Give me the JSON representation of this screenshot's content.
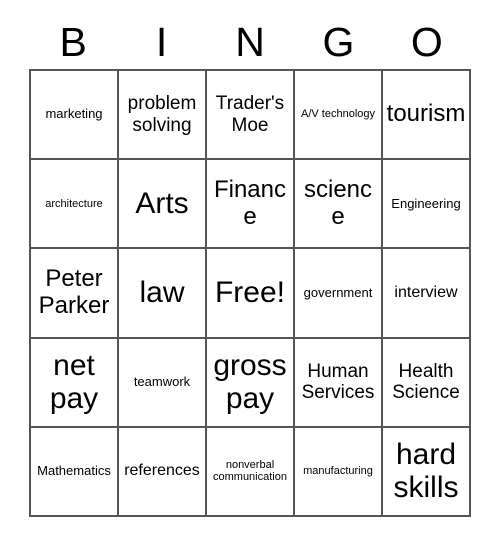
{
  "header": {
    "letters": [
      "B",
      "I",
      "N",
      "G",
      "O"
    ]
  },
  "grid": {
    "columns": 5,
    "rows": 5,
    "border_color": "#555555",
    "cell_background": "#ffffff",
    "text_color": "#000000",
    "cells": [
      {
        "text": "marketing",
        "size": "s"
      },
      {
        "text": "problem solving",
        "size": "l"
      },
      {
        "text": "Trader's Moe",
        "size": "l"
      },
      {
        "text": "A/V technology",
        "size": "xs"
      },
      {
        "text": "tourism",
        "size": "xl"
      },
      {
        "text": "architecture",
        "size": "xs"
      },
      {
        "text": "Arts",
        "size": "xxl"
      },
      {
        "text": "Finance",
        "size": "xl"
      },
      {
        "text": "science",
        "size": "xl"
      },
      {
        "text": "Engineering",
        "size": "s"
      },
      {
        "text": "Peter Parker",
        "size": "xl"
      },
      {
        "text": "law",
        "size": "xxl"
      },
      {
        "text": "Free!",
        "size": "xxl"
      },
      {
        "text": "government",
        "size": "s"
      },
      {
        "text": "interview",
        "size": "m"
      },
      {
        "text": "net pay",
        "size": "xxl"
      },
      {
        "text": "teamwork",
        "size": "s"
      },
      {
        "text": "gross pay",
        "size": "xxl"
      },
      {
        "text": "Human Services",
        "size": "l"
      },
      {
        "text": "Health Science",
        "size": "l"
      },
      {
        "text": "Mathematics",
        "size": "s"
      },
      {
        "text": "references",
        "size": "m"
      },
      {
        "text": "nonverbal communication",
        "size": "xs"
      },
      {
        "text": "manufacturing",
        "size": "xs"
      },
      {
        "text": "hard skills",
        "size": "xxl"
      }
    ]
  }
}
